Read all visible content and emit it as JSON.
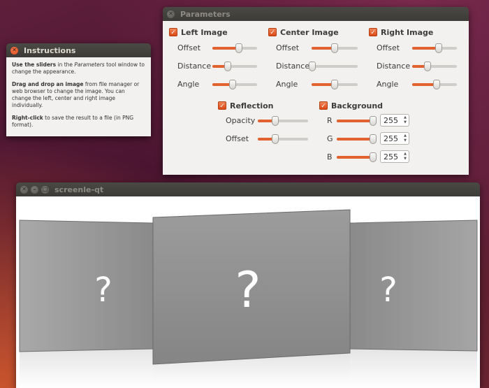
{
  "instructions": {
    "title": "Instructions",
    "p1_bold": "Use the sliders",
    "p1_a": " in the ",
    "p1_em": "Parameters",
    "p1_b": " tool window to change the appearance.",
    "p2_bold": "Drag and drop an image",
    "p2_rest": " from file manager or web browser to change the image. You can change the left, center and right image individually.",
    "p3_bold": "Right-click",
    "p3_rest": " to save the result to a file (in PNG format)."
  },
  "parameters": {
    "title": "Parameters",
    "left_image": {
      "label": "Left Image",
      "checked": true,
      "offset_label": "Offset",
      "offset": 0.6,
      "distance_label": "Distance",
      "distance": 0.35,
      "angle_label": "Angle",
      "angle": 0.45
    },
    "center_image": {
      "label": "Center Image",
      "checked": true,
      "offset_label": "Offset",
      "offset": 0.5,
      "distance_label": "Distance",
      "distance": 0.02,
      "angle_label": "Angle",
      "angle": 0.5
    },
    "right_image": {
      "label": "Right Image",
      "checked": true,
      "offset_label": "Offset",
      "offset": 0.6,
      "distance_label": "Distance",
      "distance": 0.35,
      "angle_label": "Angle",
      "angle": 0.55
    },
    "reflection": {
      "label": "Reflection",
      "checked": true,
      "opacity_label": "Opacity",
      "opacity": 0.35,
      "offset_label": "Offset",
      "offset": 0.35
    },
    "background": {
      "label": "Background",
      "checked": true,
      "r_label": "R",
      "r": "255",
      "r_frac": 1.0,
      "g_label": "G",
      "g": "255",
      "g_frac": 1.0,
      "b_label": "B",
      "b": "255",
      "b_frac": 1.0
    }
  },
  "screenlie": {
    "title": "screenle-qt",
    "placeholder": "?"
  },
  "colors": {
    "accent": "#dd4814",
    "titlebar": "#3c3b37",
    "window_bg": "#f2f1f0"
  }
}
